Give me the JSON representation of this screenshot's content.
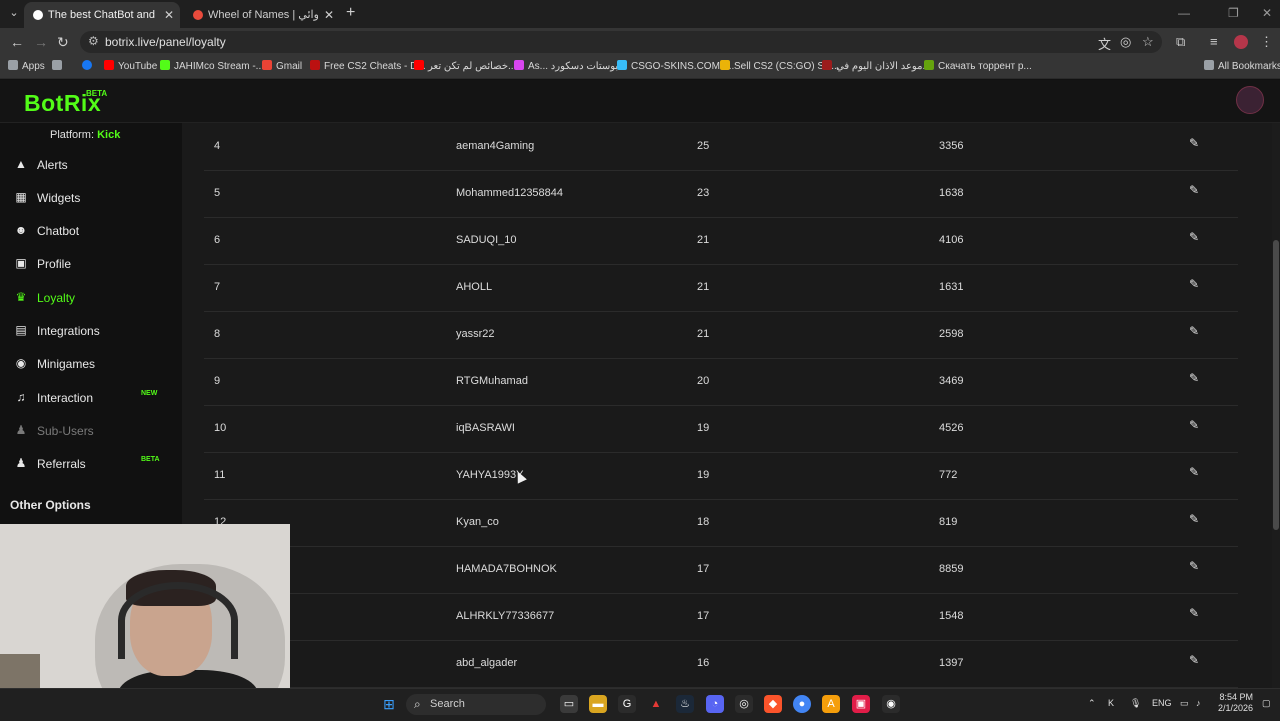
{
  "browser": {
    "tabs": [
      {
        "title": "The best ChatBot and Widgets",
        "fav_color": "#ffffff"
      },
      {
        "title": "Wheel of Names | اسم العشوائي",
        "fav_color": "#e94b3c"
      }
    ],
    "url": "botrix.live/panel/loyalty",
    "bookmarks": [
      {
        "label": "Apps",
        "color": "#9aa0a6"
      },
      {
        "label": "",
        "color": "#9aa0a6"
      },
      {
        "label": "",
        "color": "#1877f2"
      },
      {
        "label": "YouTube",
        "color": "#ff0000"
      },
      {
        "label": "JAHIMco Stream -...",
        "color": "#53fc18"
      },
      {
        "label": "Gmail",
        "color": "#ea4335"
      },
      {
        "label": "Free CS2 Cheats - D...",
        "color": "#b11"
      },
      {
        "label": "خصائص لم تكن تعر...",
        "color": "#ff0000"
      },
      {
        "label": "As... بوستات دسكورد",
        "color": "#d946ef"
      },
      {
        "label": "CSGO-SKINS.COM -...",
        "color": "#38bdf8"
      },
      {
        "label": "Sell CS2 (CS:GO) Ski...",
        "color": "#eab308"
      },
      {
        "label": "موعد الاذان اليوم في...",
        "color": "#9b1c1c"
      },
      {
        "label": "Скачать торрент р...",
        "color": "#65a30d"
      }
    ],
    "all_bookmarks": "All Bookmarks"
  },
  "app": {
    "logo": "BotRix",
    "logo_badge": "BETA",
    "platform_label": "Platform:",
    "platform_value": "Kick"
  },
  "sidebar": {
    "items": [
      {
        "label": "Alerts",
        "icon": "▲",
        "state": "normal",
        "badge": ""
      },
      {
        "label": "Widgets",
        "icon": "▦",
        "state": "normal",
        "badge": ""
      },
      {
        "label": "Chatbot",
        "icon": "☻",
        "state": "normal",
        "badge": ""
      },
      {
        "label": "Profile",
        "icon": "▣",
        "state": "normal",
        "badge": ""
      },
      {
        "label": "Loyalty",
        "icon": "♛",
        "state": "active",
        "badge": ""
      },
      {
        "label": "Integrations",
        "icon": "▤",
        "state": "normal",
        "badge": ""
      },
      {
        "label": "Minigames",
        "icon": "◉",
        "state": "normal",
        "badge": ""
      },
      {
        "label": "Interaction",
        "icon": "♫",
        "state": "normal",
        "badge": "NEW"
      },
      {
        "label": "Sub-Users",
        "icon": "♟",
        "state": "disabled",
        "badge": ""
      },
      {
        "label": "Referrals",
        "icon": "♟",
        "state": "normal",
        "badge": "BETA"
      }
    ],
    "other_options": "Other Options"
  },
  "leaderboard": {
    "rows": [
      {
        "rank": "4",
        "user": "aeman4Gaming",
        "level": "25",
        "points": "3356"
      },
      {
        "rank": "5",
        "user": "Mohammed12358844",
        "level": "23",
        "points": "1638"
      },
      {
        "rank": "6",
        "user": "SADUQI_10",
        "level": "21",
        "points": "4106"
      },
      {
        "rank": "7",
        "user": "AHOLL",
        "level": "21",
        "points": "1631"
      },
      {
        "rank": "8",
        "user": "yassr22",
        "level": "21",
        "points": "2598"
      },
      {
        "rank": "9",
        "user": "RTGMuhamad",
        "level": "20",
        "points": "3469"
      },
      {
        "rank": "10",
        "user": "iqBASRAWI",
        "level": "19",
        "points": "4526"
      },
      {
        "rank": "11",
        "user": "YAHYA1993Y",
        "level": "19",
        "points": "772"
      },
      {
        "rank": "12",
        "user": "Kyan_co",
        "level": "18",
        "points": "819"
      },
      {
        "rank": "",
        "user": "HAMADA7BOHNOK",
        "level": "17",
        "points": "8859"
      },
      {
        "rank": "",
        "user": "ALHRKLY77336677",
        "level": "17",
        "points": "1548"
      },
      {
        "rank": "",
        "user": "abd_algader",
        "level": "16",
        "points": "1397"
      }
    ]
  },
  "taskbar": {
    "search_label": "Search",
    "lang": "ENG",
    "time": "8:54 PM",
    "date": "2/1/2026",
    "notification_badge": "9+"
  }
}
